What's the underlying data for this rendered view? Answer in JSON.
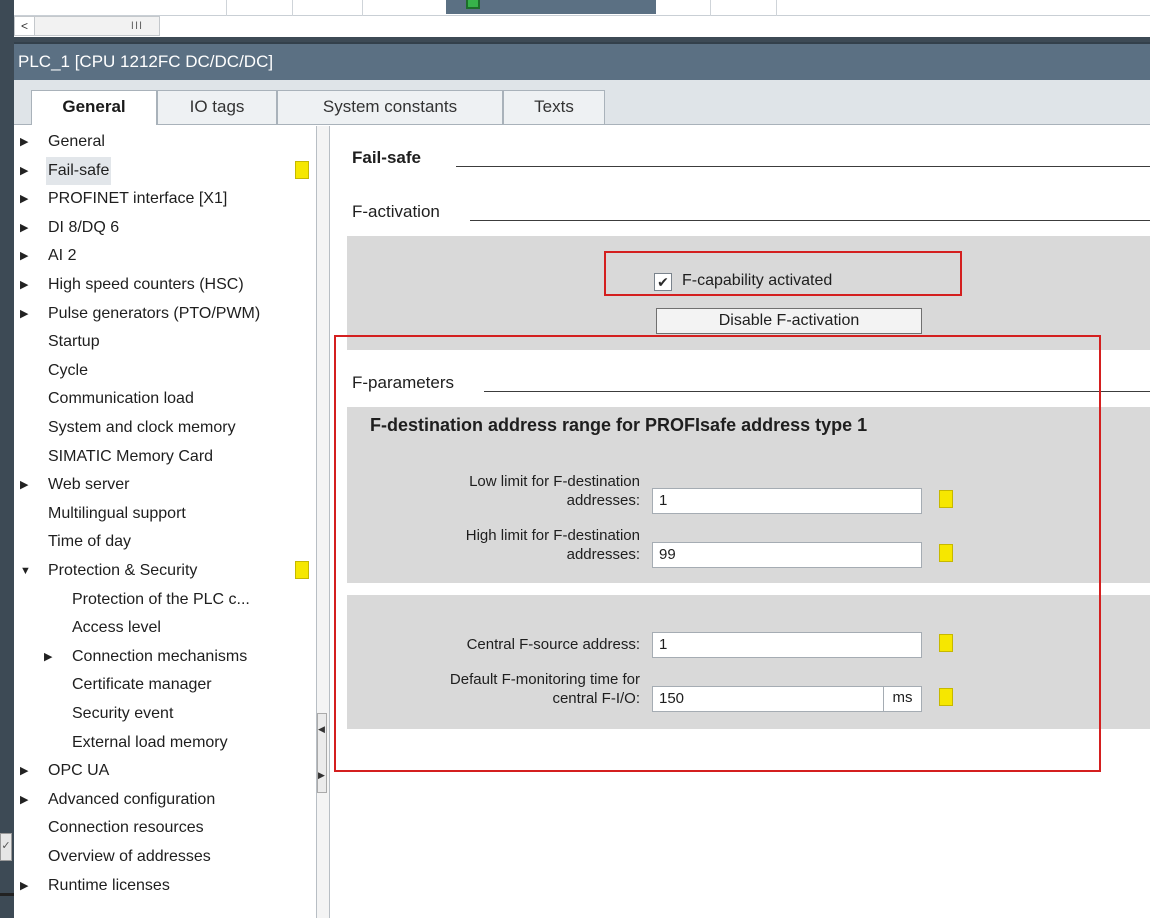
{
  "top": {
    "scroll_left": "<",
    "scroll_thumb": "III"
  },
  "window": {
    "title": "PLC_1 [CPU 1212FC DC/DC/DC]"
  },
  "tabs": [
    {
      "label": "General",
      "active": true
    },
    {
      "label": "IO tags",
      "active": false
    },
    {
      "label": "System constants",
      "active": false
    },
    {
      "label": "Texts",
      "active": false
    }
  ],
  "nav": {
    "items": [
      {
        "label": "General",
        "arrow": "▶"
      },
      {
        "label": "Fail-safe",
        "arrow": "▶"
      },
      {
        "label": "PROFINET interface [X1]",
        "arrow": "▶"
      },
      {
        "label": "DI 8/DQ 6",
        "arrow": "▶"
      },
      {
        "label": "AI 2",
        "arrow": "▶"
      },
      {
        "label": "High speed counters (HSC)",
        "arrow": "▶"
      },
      {
        "label": "Pulse generators (PTO/PWM)",
        "arrow": "▶"
      },
      {
        "label": "Startup",
        "arrow": ""
      },
      {
        "label": "Cycle",
        "arrow": ""
      },
      {
        "label": "Communication load",
        "arrow": ""
      },
      {
        "label": "System and clock memory",
        "arrow": ""
      },
      {
        "label": "SIMATIC Memory Card",
        "arrow": ""
      },
      {
        "label": "Web server",
        "arrow": "▶"
      },
      {
        "label": "Multilingual support",
        "arrow": ""
      },
      {
        "label": "Time of day",
        "arrow": ""
      },
      {
        "label": "Protection & Security",
        "arrow": "▼"
      },
      {
        "label": "Protection of the PLC c...",
        "arrow": ""
      },
      {
        "label": "Access level",
        "arrow": ""
      },
      {
        "label": "Connection mechanisms",
        "arrow": "▶"
      },
      {
        "label": "Certificate manager",
        "arrow": ""
      },
      {
        "label": "Security event",
        "arrow": ""
      },
      {
        "label": "External load memory",
        "arrow": ""
      },
      {
        "label": "OPC UA",
        "arrow": "▶"
      },
      {
        "label": "Advanced configuration",
        "arrow": "▶"
      },
      {
        "label": "Connection resources",
        "arrow": ""
      },
      {
        "label": "Overview of addresses",
        "arrow": ""
      },
      {
        "label": "Runtime licenses",
        "arrow": "▶"
      }
    ],
    "selected_index": 1,
    "flag_color": "#f6e700"
  },
  "content": {
    "failsafe_title": "Fail-safe",
    "factivation_title": "F-activation",
    "fcapability_label": "F-capability activated",
    "fcapability_checked": true,
    "fcapability_check": "✔",
    "disable_button": "Disable F-activation",
    "fparameters_title": "F-parameters",
    "range_heading": "F-destination address range for PROFIsafe address type 1",
    "low_limit_label_1": "Low limit for F-destination",
    "low_limit_label_2": "addresses:",
    "low_limit_value": "1",
    "high_limit_label_1": "High limit for F-destination",
    "high_limit_label_2": "addresses:",
    "high_limit_value": "99",
    "central_source_label": "Central F-source address:",
    "central_source_value": "1",
    "monitoring_label_1": "Default F-monitoring time for",
    "monitoring_label_2": "central F-I/O:",
    "monitoring_value": "150",
    "monitoring_unit": "ms"
  },
  "colors": {
    "title_bar": "#5b7083",
    "highlight_box": "#d41f1f",
    "panel": "#d9d9d9",
    "flag": "#f6e700"
  }
}
